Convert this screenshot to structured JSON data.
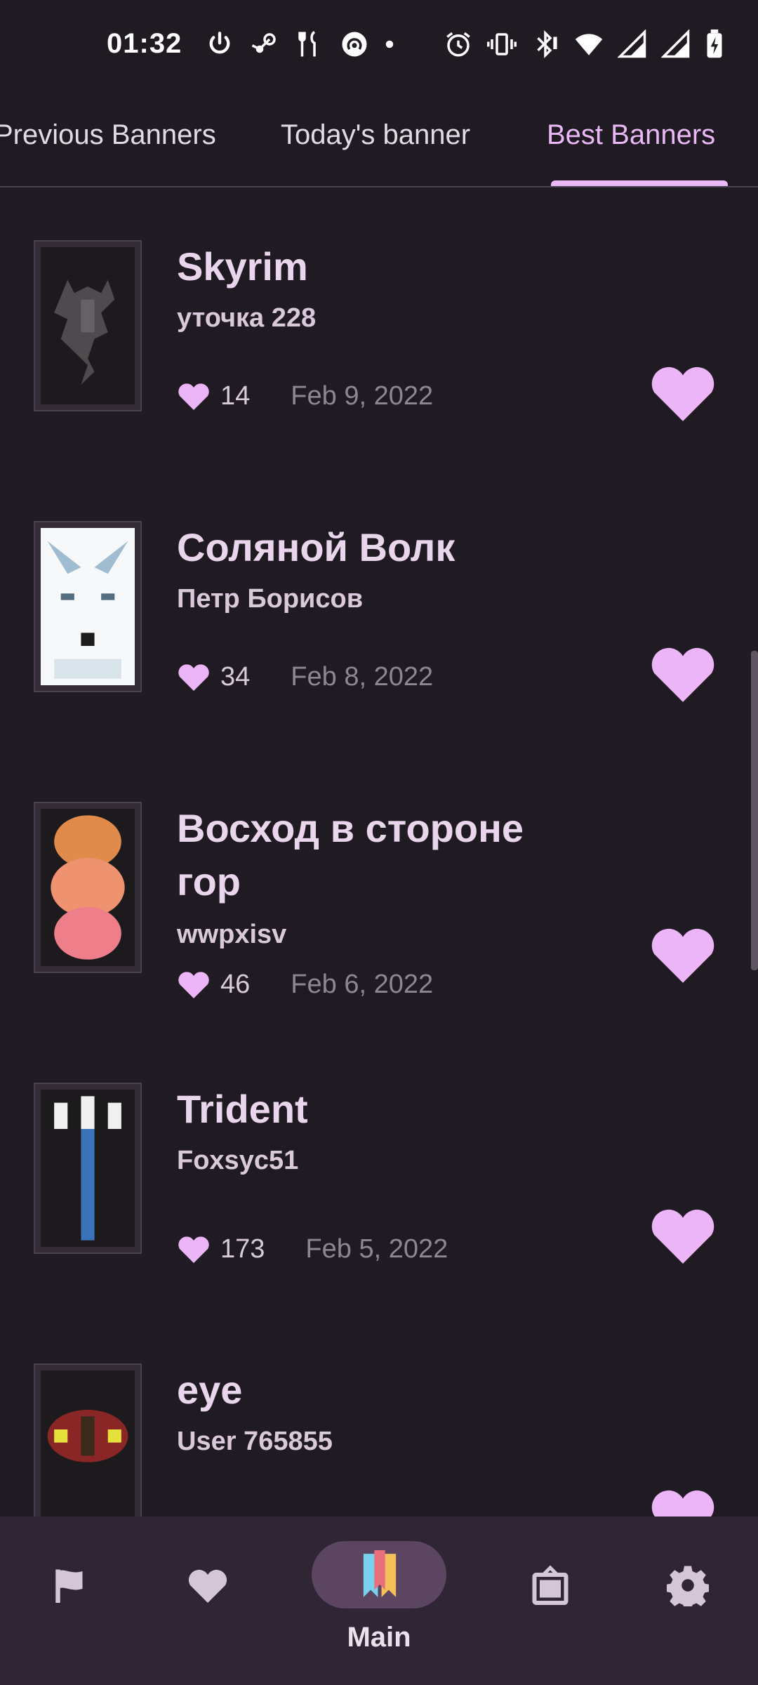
{
  "status_bar": {
    "time": "01:32",
    "left_icons": [
      "power-icon",
      "steam-icon",
      "fork-knife-icon",
      "hotspot-icon",
      "dot-icon"
    ],
    "right_icons": [
      "alarm-icon",
      "vibrate-icon",
      "bluetooth-icon",
      "wifi-icon",
      "signal-icon",
      "signal-icon-2",
      "battery-charging-icon"
    ]
  },
  "tabs": [
    {
      "label": "Previous Banners"
    },
    {
      "label": "Today's banner"
    },
    {
      "label": "Best Banners"
    }
  ],
  "active_tab": "Best Banners",
  "banners": [
    {
      "title": "Skyrim",
      "author": "уточка 228",
      "likes": "14",
      "date": "Feb 9, 2022"
    },
    {
      "title": "Соляной Волк",
      "author": "Петр Борисов",
      "likes": "34",
      "date": "Feb 8, 2022"
    },
    {
      "title": "Восход в стороне гор",
      "author": "wwpxisv",
      "likes": "46",
      "date": "Feb 6, 2022"
    },
    {
      "title": "Trident",
      "author": "Foxsyc51",
      "likes": "173",
      "date": "Feb 5, 2022"
    },
    {
      "title": "eye",
      "author": "User 765855",
      "likes": "",
      "date": ""
    }
  ],
  "bottom_nav": {
    "items": [
      "flag-icon",
      "heart-icon",
      "bookmark-icon",
      "frame-icon",
      "gear-icon"
    ],
    "active_label": "Main"
  },
  "colors": {
    "background": "#201a22",
    "accent": "#eab8f7",
    "nav_background": "#2f2534"
  }
}
